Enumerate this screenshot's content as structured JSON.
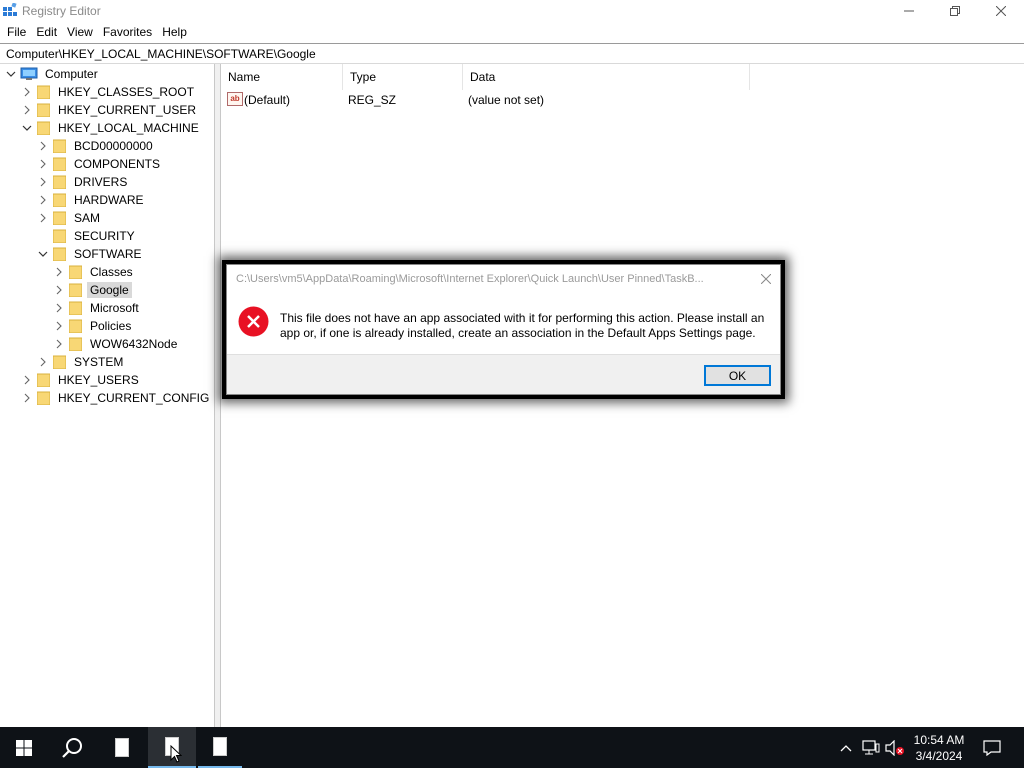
{
  "window": {
    "title": "Registry Editor",
    "menu": [
      "File",
      "Edit",
      "View",
      "Favorites",
      "Help"
    ]
  },
  "address": "Computer\\HKEY_LOCAL_MACHINE\\SOFTWARE\\Google",
  "tree": {
    "root": "Computer",
    "items": [
      {
        "label": "HKEY_CLASSES_ROOT"
      },
      {
        "label": "HKEY_CURRENT_USER"
      },
      {
        "label": "HKEY_LOCAL_MACHINE"
      },
      {
        "label": "BCD00000000"
      },
      {
        "label": "COMPONENTS"
      },
      {
        "label": "DRIVERS"
      },
      {
        "label": "HARDWARE"
      },
      {
        "label": "SAM"
      },
      {
        "label": "SECURITY"
      },
      {
        "label": "SOFTWARE"
      },
      {
        "label": "Classes"
      },
      {
        "label": "Google"
      },
      {
        "label": "Microsoft"
      },
      {
        "label": "Policies"
      },
      {
        "label": "WOW6432Node"
      },
      {
        "label": "SYSTEM"
      },
      {
        "label": "HKEY_USERS"
      },
      {
        "label": "HKEY_CURRENT_CONFIG"
      }
    ]
  },
  "list": {
    "columns": [
      "Name",
      "Type",
      "Data"
    ],
    "rows": [
      {
        "name": "(Default)",
        "type": "REG_SZ",
        "data": "(value not set)"
      }
    ]
  },
  "dialog": {
    "title": "C:\\Users\\vm5\\AppData\\Roaming\\Microsoft\\Internet Explorer\\Quick Launch\\User Pinned\\TaskB...",
    "message": "This file does not have an app associated with it for performing this action. Please install an app or, if one is already installed, create an association in the Default Apps Settings page.",
    "ok_label": "OK"
  },
  "taskbar": {
    "time": "10:54 AM",
    "date": "3/4/2024"
  },
  "colors": {
    "accent": "#0078d7",
    "error": "#e81123",
    "taskbar": "#0e1217",
    "folder": "#f8d775"
  }
}
